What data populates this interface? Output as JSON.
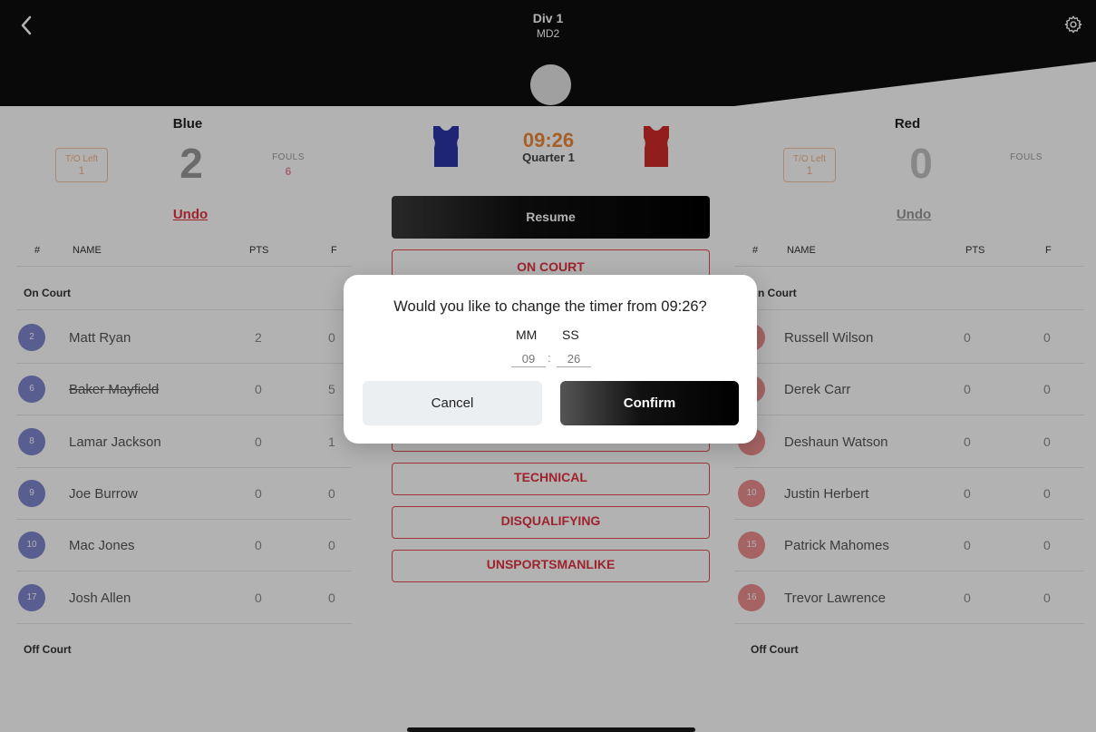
{
  "header": {
    "title": "Div 1",
    "subtitle": "MD2"
  },
  "teams": {
    "home": {
      "name": "Blue",
      "to_label": "T/O Left",
      "to_value": "1",
      "score": "2",
      "fouls_label": "FOULS",
      "fouls_value": "6",
      "undo_label": "Undo",
      "jersey_color": "#2b36a8",
      "accent": "#e2333f",
      "players": [
        {
          "num": "2",
          "name": "Matt Ryan",
          "pts": "2",
          "f": "0"
        },
        {
          "num": "6",
          "name": "Baker Mayfield",
          "pts": "0",
          "f": "5"
        },
        {
          "num": "8",
          "name": "Lamar Jackson",
          "pts": "0",
          "f": "1"
        },
        {
          "num": "9",
          "name": "Joe Burrow",
          "pts": "0",
          "f": "0"
        },
        {
          "num": "10",
          "name": "Mac Jones",
          "pts": "0",
          "f": "0"
        },
        {
          "num": "17",
          "name": "Josh Allen",
          "pts": "0",
          "f": "0"
        }
      ]
    },
    "away": {
      "name": "Red",
      "to_label": "T/O Left",
      "to_value": "1",
      "score": "0",
      "fouls_label": "FOULS",
      "undo_label": "Undo",
      "jersey_color": "#d22a2a",
      "players": [
        {
          "name": "Russell Wilson",
          "pts": "0",
          "f": "0"
        },
        {
          "name": "Derek Carr",
          "pts": "0",
          "f": "0"
        },
        {
          "name": "Deshaun Watson",
          "pts": "0",
          "f": "0"
        },
        {
          "num": "10",
          "name": "Justin Herbert",
          "pts": "0",
          "f": "0"
        },
        {
          "num": "15",
          "name": "Patrick Mahomes",
          "pts": "0",
          "f": "0"
        },
        {
          "num": "16",
          "name": "Trevor Lawrence",
          "pts": "0",
          "f": "0"
        }
      ]
    }
  },
  "table": {
    "col_num": "#",
    "col_name": "NAME",
    "col_pts": "PTS",
    "col_f": "F",
    "on_court": "On Court",
    "on_court_right": "n Court",
    "off_court": "Off Court"
  },
  "center": {
    "clock": "09:26",
    "quarter": "Quarter 1",
    "resume_label": "Resume",
    "on_court_label": "ON COURT",
    "foul_buttons": [
      "TECHNICAL",
      "DISQUALIFYING",
      "UNSPORTSMANLIKE"
    ]
  },
  "dialog": {
    "title": "Would you like to change the timer from 09:26?",
    "mm_label": "MM",
    "ss_label": "SS",
    "mm_value": "09",
    "ss_value": "26",
    "colon": ":",
    "cancel_label": "Cancel",
    "confirm_label": "Confirm"
  },
  "icons": {
    "back": "chevron-left-icon",
    "settings": "gear-icon"
  }
}
